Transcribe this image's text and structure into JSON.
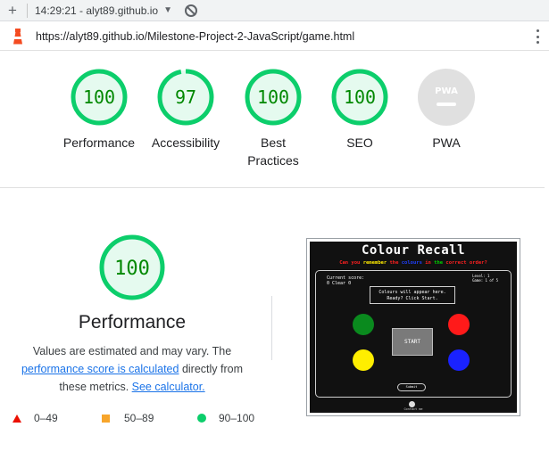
{
  "topbar": {
    "time_site": "14:29:21 - alyt89.github.io"
  },
  "urlbar": {
    "url": "https://alyt89.github.io/Milestone-Project-2-JavaScript/game.html"
  },
  "gauges": [
    {
      "label": "Performance",
      "score": "100",
      "fraction": 1.0
    },
    {
      "label": "Accessibility",
      "score": "97",
      "fraction": 0.97
    },
    {
      "label": "Best Practices",
      "score": "100",
      "fraction": 1.0
    },
    {
      "label": "SEO",
      "score": "100",
      "fraction": 1.0
    },
    {
      "label": "PWA",
      "badge": "PWA"
    }
  ],
  "performance": {
    "score": "100",
    "title": "Performance",
    "desc_pre": "Values are estimated and may vary. The ",
    "desc_link": "performance score is calculated",
    "desc_mid": " directly from these metrics. ",
    "calc_link": "See calculator."
  },
  "legend": [
    {
      "range": "0–49",
      "color": "#eb0f00"
    },
    {
      "range": "50–89",
      "color": "#f7a52b"
    },
    {
      "range": "90–100",
      "color": "#0cce6b"
    }
  ],
  "game": {
    "title": "Colour Recall",
    "sub_1": "Can you ",
    "sub_remember": "remember",
    "sub_2": " the ",
    "sub_colours": "colours",
    "sub_3": " in ",
    "sub_the": "the",
    "sub_correct": " correct order?",
    "score_label": "Current score:",
    "score_value": "0 Clear 0",
    "level": "Level: 1",
    "game_count": "Game: 1 of 5",
    "message_1": "Colours will appear here.",
    "message_2": "Ready? Click Start.",
    "start": "START",
    "submit": "Submit",
    "contact": "Contact me"
  },
  "colors": {
    "pass_green": "#0cce6b",
    "pass_bg": "#e5faef",
    "pass_text": "#008800",
    "pwa_gray": "#e0e0e0"
  }
}
